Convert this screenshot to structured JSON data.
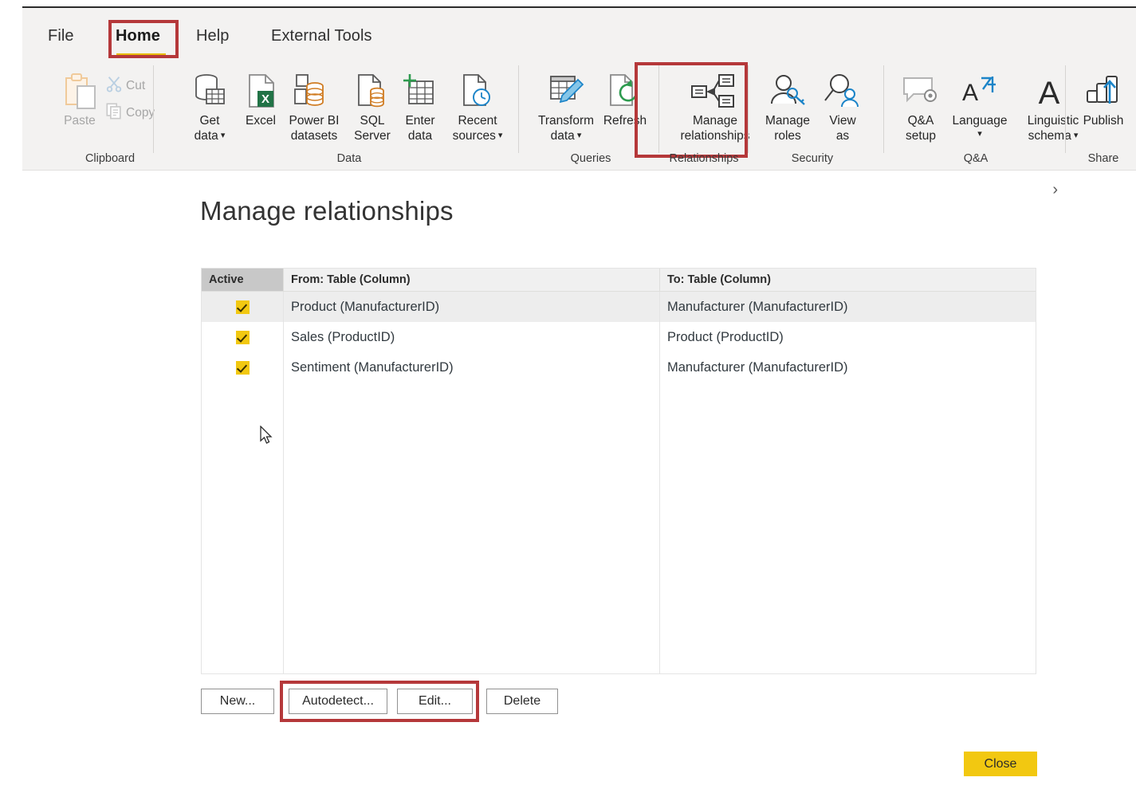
{
  "app": {
    "ribbon": {
      "tabs": [
        {
          "id": "file",
          "label": "File"
        },
        {
          "id": "home",
          "label": "Home",
          "selected": true
        },
        {
          "id": "help",
          "label": "Help"
        },
        {
          "id": "external-tools",
          "label": "External Tools"
        }
      ],
      "groups": [
        {
          "id": "clipboard",
          "label": "Clipboard"
        },
        {
          "id": "data",
          "label": "Data"
        },
        {
          "id": "queries",
          "label": "Queries"
        },
        {
          "id": "relationships",
          "label": "Relationships"
        },
        {
          "id": "security",
          "label": "Security"
        },
        {
          "id": "qna",
          "label": "Q&A"
        },
        {
          "id": "share",
          "label": "Share"
        }
      ],
      "buttons": {
        "paste": {
          "label": "Paste",
          "icon": "paste-icon",
          "disabled": true
        },
        "cut": {
          "label": "Cut",
          "icon": "scissors-icon",
          "disabled": true
        },
        "copy": {
          "label": "Copy",
          "icon": "copy-icon",
          "disabled": true
        },
        "get_data": {
          "label_line1": "Get",
          "label_line2": "data",
          "icon": "database-table-icon",
          "dropdown": true
        },
        "excel": {
          "label_line1": "Excel",
          "label_line2": "",
          "icon": "excel-icon"
        },
        "powerbi_datasets": {
          "label_line1": "Power BI",
          "label_line2": "datasets",
          "icon": "powerbi-dataset-icon"
        },
        "sql_server": {
          "label_line1": "SQL",
          "label_line2": "Server",
          "icon": "sql-server-icon"
        },
        "enter_data": {
          "label_line1": "Enter",
          "label_line2": "data",
          "icon": "enter-data-icon"
        },
        "recent_sources": {
          "label_line1": "Recent",
          "label_line2": "sources",
          "icon": "recent-sources-icon",
          "dropdown": true
        },
        "transform_data": {
          "label_line1": "Transform",
          "label_line2": "data",
          "icon": "transform-data-icon",
          "dropdown": true
        },
        "refresh": {
          "label_line1": "Refresh",
          "label_line2": "",
          "icon": "refresh-icon"
        },
        "manage_relationships": {
          "label_line1": "Manage",
          "label_line2": "relationships",
          "icon": "manage-relationships-icon",
          "highlighted": true
        },
        "manage_roles": {
          "label_line1": "Manage",
          "label_line2": "roles",
          "icon": "manage-roles-icon"
        },
        "view_as": {
          "label_line1": "View",
          "label_line2": "as",
          "icon": "view-as-icon"
        },
        "qna_setup": {
          "label_line1": "Q&A",
          "label_line2": "setup",
          "icon": "qna-setup-icon"
        },
        "language": {
          "label_line1": "Language",
          "label_line2": "",
          "icon": "language-icon",
          "dropdown": true
        },
        "linguistic_schema": {
          "label_line1": "Linguistic",
          "label_line2": "schema",
          "icon": "linguistic-schema-icon",
          "dropdown": true
        },
        "publish": {
          "label_line1": "Publish",
          "label_line2": "",
          "icon": "publish-icon"
        }
      }
    },
    "dialog": {
      "title": "Manage relationships",
      "expand_chevron": "›",
      "table": {
        "columns": [
          "Active",
          "From: Table (Column)",
          "To: Table (Column)"
        ],
        "rows": [
          {
            "active": true,
            "from": "Product (ManufacturerID)",
            "to": "Manufacturer (ManufacturerID)",
            "selected": true
          },
          {
            "active": true,
            "from": "Sales (ProductID)",
            "to": "Product (ProductID)",
            "selected": false
          },
          {
            "active": true,
            "from": "Sentiment (ManufacturerID)",
            "to": "Manufacturer (ManufacturerID)",
            "selected": false
          }
        ]
      },
      "buttons": {
        "new": "New...",
        "autodetect": "Autodetect...",
        "edit": "Edit...",
        "delete": "Delete",
        "close": "Close"
      }
    },
    "colors": {
      "accent_yellow": "#f2c811",
      "highlight_red": "#b5383a",
      "ribbon_bg": "#f3f2f1",
      "row_selected": "#ededed",
      "header_bg": "#f0f0f0",
      "active_col_header_bg": "#c8c8c8"
    }
  }
}
